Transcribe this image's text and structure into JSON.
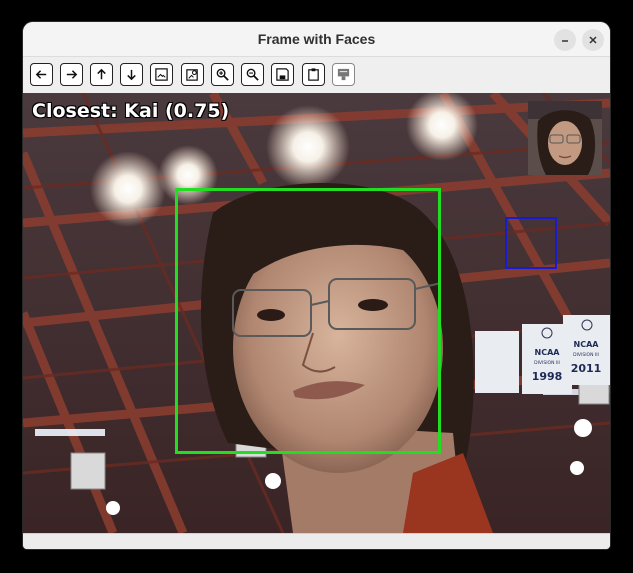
{
  "window": {
    "title": "Frame with Faces"
  },
  "titlebar_buttons": [
    {
      "name": "minimize-button",
      "icon": "minimize-icon"
    },
    {
      "name": "close-button",
      "icon": "close-icon"
    }
  ],
  "toolbar": {
    "buttons": [
      {
        "name": "back-button",
        "icon": "arrow-left-icon",
        "enabled": true
      },
      {
        "name": "forward-button",
        "icon": "arrow-right-icon",
        "enabled": true
      },
      {
        "name": "up-button",
        "icon": "arrow-up-icon",
        "enabled": true
      },
      {
        "name": "down-button",
        "icon": "arrow-down-icon",
        "enabled": true
      },
      {
        "name": "image-button",
        "icon": "image-icon",
        "enabled": true
      },
      {
        "name": "image-settings-button",
        "icon": "image-settings-icon",
        "enabled": true
      },
      {
        "name": "zoom-in-button",
        "icon": "zoom-in-icon",
        "enabled": true
      },
      {
        "name": "zoom-out-button",
        "icon": "zoom-out-icon",
        "enabled": true
      },
      {
        "name": "save-button",
        "icon": "save-icon",
        "enabled": true
      },
      {
        "name": "clipboard-button",
        "icon": "clipboard-icon",
        "enabled": true
      },
      {
        "name": "properties-button",
        "icon": "properties-icon",
        "enabled": false
      }
    ]
  },
  "frame": {
    "overlay_label": "Closest: Kai (0.75)",
    "face_box_color": "#22dd22",
    "secondary_box_color": "#1a1ad0",
    "banners": [
      {
        "line1": "NCAA",
        "line2": "DIVISION III",
        "year": "1998"
      },
      {
        "line1": "NCAA",
        "line2": "DIVISION III",
        "year": "2011"
      }
    ]
  },
  "colors": {
    "titlebar_bg": "#f4f4f4",
    "window_bg": "#ececec",
    "title_text": "#303030"
  }
}
